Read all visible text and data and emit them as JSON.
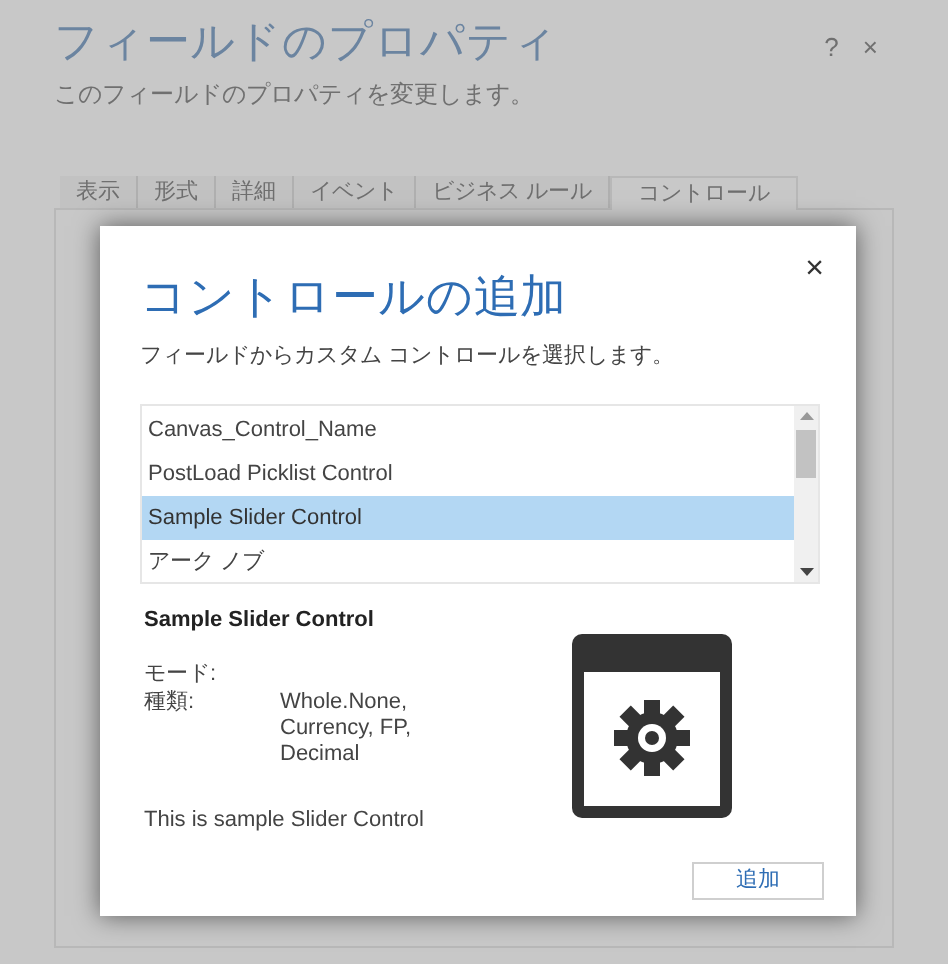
{
  "background_dialog": {
    "title": "フィールドのプロパティ",
    "subtitle": "このフィールドのプロパティを変更します。",
    "help": "?",
    "close": "×",
    "tabs": [
      {
        "label": "表示",
        "selected": false
      },
      {
        "label": "形式",
        "selected": false
      },
      {
        "label": "詳細",
        "selected": false
      },
      {
        "label": "イベント",
        "selected": false
      },
      {
        "label": "ビジネス ルール",
        "selected": false
      },
      {
        "label": "コントロール",
        "selected": true
      }
    ]
  },
  "modal": {
    "title": "コントロールの追加",
    "close": "×",
    "subtitle": "フィールドからカスタム コントロールを選択します。",
    "controls": [
      {
        "label": "Canvas_Control_Name",
        "selected": false
      },
      {
        "label": "PostLoad Picklist Control",
        "selected": false
      },
      {
        "label": "Sample Slider Control",
        "selected": true
      },
      {
        "label": "アーク ノブ",
        "selected": false
      }
    ],
    "details": {
      "name": "Sample Slider Control",
      "fields": [
        {
          "label": "モード:"
        },
        {
          "label": "種類:",
          "value": "Whole.None, Currency, FP, Decimal"
        }
      ],
      "description": "This is sample Slider Control"
    },
    "add_button": "追加"
  }
}
